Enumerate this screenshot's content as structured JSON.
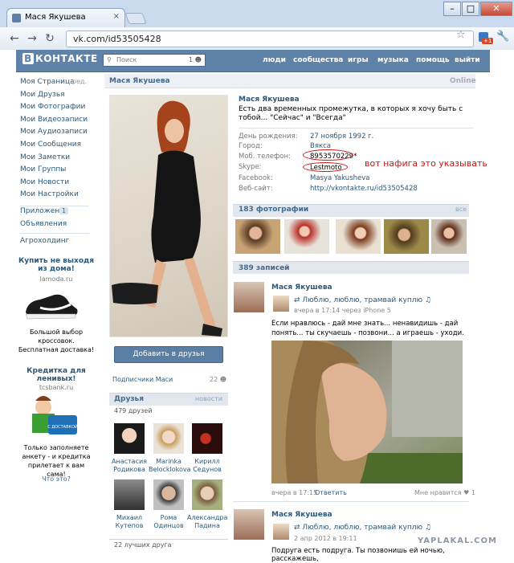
{
  "browser": {
    "tab_title": "Мася Якушева",
    "url": "vk.com/id53505428",
    "window_controls": [
      "–",
      "□",
      "✕"
    ],
    "badge": "+1"
  },
  "header": {
    "logo": "КОНТАКТЕ",
    "logo_b": "В",
    "search_placeholder": "Поиск",
    "nav": [
      "люди",
      "сообщества",
      "игры",
      "музыка",
      "помощь",
      "выйти"
    ]
  },
  "sidebar": {
    "items": [
      "Моя Страница",
      "Мои Друзья",
      "Мои Фотографии",
      "Мои Видеозаписи",
      "Мои Аудиозаписи",
      "Мои Сообщения",
      "Мои Заметки",
      "Мои Группы",
      "Мои Новости",
      "Мои Настройки"
    ],
    "edit": "ред.",
    "apps": "Приложения",
    "apps_count": "1",
    "ads": "Объявления",
    "agro": "Агрохолдинг",
    "ad1": {
      "title": "Купить не выходя из дома!",
      "domain": "lamoda.ru",
      "text": "Большой выбор кроссовок. Бесплатная доставка!"
    },
    "ad2": {
      "title": "Кредитка для ленивых!",
      "domain": "tcsbank.ru",
      "card_label": "С ДОСТАВКОЙ",
      "text": "Только заполняете анкету - и кредитка прилетает к вам сама!"
    },
    "what": "Что это?"
  },
  "profile": {
    "name": "Мася Якушева",
    "online": "Online",
    "status": "Есть два временных промежутка, в которых я хочу быть с тобой... \"Сейчас\" и \"Всегда\"",
    "info": [
      {
        "label": "День рождения:",
        "value": "27 ноября 1992 г."
      },
      {
        "label": "Город:",
        "value": "Вякса"
      },
      {
        "label": "Моб. телефон:",
        "value": "8953570229*"
      },
      {
        "label": "Skype:",
        "value": "Lestmoto"
      },
      {
        "label": "Facebook:",
        "value": "Masya Yakusheva"
      },
      {
        "label": "Веб-сайт:",
        "value": "http://vkontakte.ru/id53505428"
      }
    ],
    "annotation": "вот нафига это указывать",
    "add_friend": "Добавить в друзья",
    "subscribers": "Подписчики Маси",
    "subscribers_count": "22",
    "photos_title": "183 фотографии",
    "photos_all": "все",
    "posts_title": "389 записей"
  },
  "friends": {
    "title": "Друзья",
    "new": "новости",
    "count": "479 друзей",
    "list": [
      {
        "first": "Анастасия",
        "last": "Родикова"
      },
      {
        "first": "Marinka",
        "last": "Belocklokova"
      },
      {
        "first": "Кирилл",
        "last": "Седунов"
      },
      {
        "first": "Михаил",
        "last": "Кутепов"
      },
      {
        "first": "Рома",
        "last": "Одинцов"
      },
      {
        "first": "Александра",
        "last": "Падина"
      }
    ],
    "best": "22 лучших друга"
  },
  "posts": [
    {
      "author": "Мася Якушева",
      "repost": "Люблю, люблю, трамвай куплю",
      "repost_meta": "вчера в 17:14 через iPhone 5",
      "text": "Если нравлюсь - дай мне знать... ненавидишь - дай понять... ты скучаешь - позвони... а играешь - уходи.",
      "meta": "вчера в 17:15",
      "reply": "Ответить",
      "like": "Мне нравится",
      "like_count": "1"
    },
    {
      "author": "Мася Якушева",
      "repost": "Люблю, люблю, трамвай куплю",
      "repost_meta": "2 апр 2012 в 19:11",
      "text": "Подруга есть подруга. Ты позвонишь ей ночью, расскажешь,"
    }
  ],
  "watermark": "YAPLAKAL.COM",
  "colors": {
    "vk_blue": "#5e82a8",
    "link": "#2b587a",
    "annotation_red": "#c71616"
  }
}
